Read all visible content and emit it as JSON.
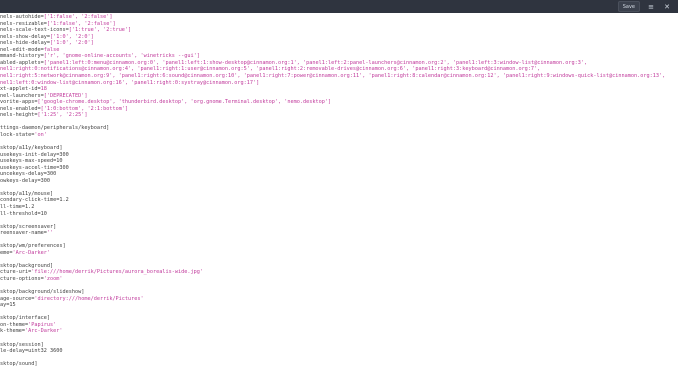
{
  "header": {
    "save_label": "Save",
    "menu_icon": "hamburger-menu-icon",
    "close_icon": "close-icon"
  },
  "colors": {
    "text": "#3f3f3f",
    "string": "#c0399b",
    "header_bg": "#2f343f"
  },
  "lines": [
    {
      "k": "nels-autohide=",
      "v": "['1:false', '2:false']"
    },
    {
      "k": "nels-resizable=",
      "v": "['1:false', '2:false']"
    },
    {
      "k": "nels-scale-text-icons=",
      "v": "['1:true', '2:true']"
    },
    {
      "k": "nels-show-delay=",
      "v": "['1:0', '2:0']"
    },
    {
      "k": "nels-hide-delay=",
      "v": "['1:0', '2:0']"
    },
    {
      "k": "nel-edit-mode=",
      "v": "false"
    },
    {
      "k": "mmand-history=",
      "v": "['r', 'gnome-online-accounts', 'winetricks --gui']"
    },
    {
      "k": "abled-applets=",
      "v": "['panel1:left:0:menu@cinnamon.org:0', 'panel1:left:1:show-desktop@cinnamon.org:1', 'panel1:left:2:panel-launchers@cinnamon.org:2', 'panel1:left:3:window-list@cinnamon.org:3',"
    },
    {
      "k": "",
      "v": "nel1:right:0:notifications@cinnamon.org:4', 'panel1:right:1:user@cinnamon.org:5', 'panel1:right:2:removable-drives@cinnamon.org:6', 'panel1:right:3:keyboard@cinnamon.org:7',"
    },
    {
      "k": "",
      "v": "nel1:right:5:network@cinnamon.org:9', 'panel1:right:6:sound@cinnamon.org:10', 'panel1:right:7:power@cinnamon.org:11', 'panel1:right:8:calendar@cinnamon.org:12', 'panel1:right:9:windows-quick-list@cinnamon.org:13',"
    },
    {
      "k": "",
      "v": "nel1:left:0:window-list@cinnamon.org:16', 'panel1:right:0:systray@cinnamon.org:17']"
    },
    {
      "k": "xt-applet-id=",
      "v": "18"
    },
    {
      "k": "nel-launchers=",
      "v": "['DEPRECATED']"
    },
    {
      "k": "vorite-apps=",
      "v": "['google-chrome.desktop', 'thunderbird.desktop', 'org.gnome.Terminal.desktop', 'nemo.desktop']"
    },
    {
      "k": "nels-enabled=",
      "v": "['1:0:bottom', '2:1:bottom']"
    },
    {
      "k": "nels-height=",
      "v": "['1:25', '2:25']"
    },
    {
      "k": "",
      "v": ""
    },
    {
      "k": "ttings-daemon/peripherals/keyboard]",
      "v": ""
    },
    {
      "k": "lock-state=",
      "v": "'on'"
    },
    {
      "k": "",
      "v": ""
    },
    {
      "k": "sktop/a11y/keyboard]",
      "v": ""
    },
    {
      "k": "usekeys-init-delay=300",
      "v": ""
    },
    {
      "k": "usekeys-max-speed=10",
      "v": ""
    },
    {
      "k": "usekeys-accel-time=300",
      "v": ""
    },
    {
      "k": "uncekeys-delay=300",
      "v": ""
    },
    {
      "k": "owkeys-delay=300",
      "v": ""
    },
    {
      "k": "",
      "v": ""
    },
    {
      "k": "sktop/a11y/mouse]",
      "v": ""
    },
    {
      "k": "condary-click-time=1.2",
      "v": ""
    },
    {
      "k": "ll-time=1.2",
      "v": ""
    },
    {
      "k": "ll-threshold=10",
      "v": ""
    },
    {
      "k": "",
      "v": ""
    },
    {
      "k": "sktop/screensaver]",
      "v": ""
    },
    {
      "k": "reensaver-name=",
      "v": "''"
    },
    {
      "k": "",
      "v": ""
    },
    {
      "k": "sktop/wm/preferences]",
      "v": ""
    },
    {
      "k": "eme=",
      "v": "'Arc-Darker'"
    },
    {
      "k": "",
      "v": ""
    },
    {
      "k": "sktop/background]",
      "v": ""
    },
    {
      "k": "cture-uri=",
      "v": "'file:///home/derrik/Pictures/aurora_borealis-wide.jpg'"
    },
    {
      "k": "cture-options=",
      "v": "'zoom'"
    },
    {
      "k": "",
      "v": ""
    },
    {
      "k": "sktop/background/slideshow]",
      "v": ""
    },
    {
      "k": "age-source=",
      "v": "'directory:///home/derrik/Pictures'"
    },
    {
      "k": "ay=15",
      "v": ""
    },
    {
      "k": "",
      "v": ""
    },
    {
      "k": "sktop/interface]",
      "v": ""
    },
    {
      "k": "on-theme=",
      "v": "'Papirus'"
    },
    {
      "k": "k-theme=",
      "v": "'Arc-Darker'"
    },
    {
      "k": "",
      "v": ""
    },
    {
      "k": "sktop/session]",
      "v": ""
    },
    {
      "k": "le-delay=uint32 3600",
      "v": ""
    },
    {
      "k": "",
      "v": ""
    },
    {
      "k": "sktop/sound]",
      "v": ""
    }
  ]
}
